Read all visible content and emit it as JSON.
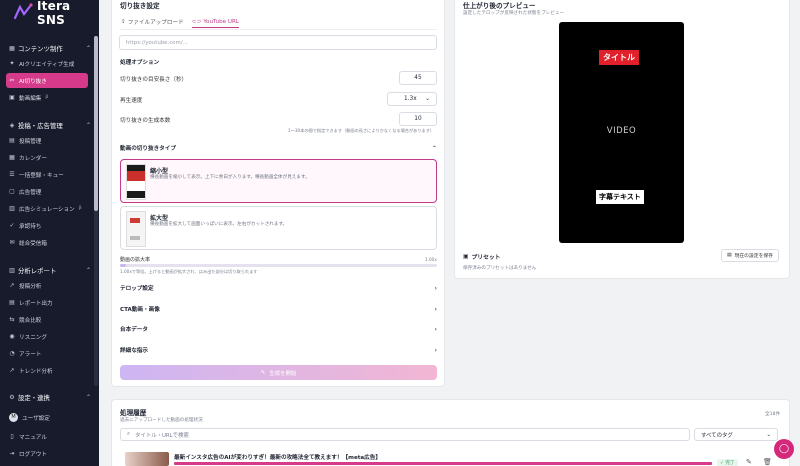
{
  "app": {
    "name": "Itera SNS"
  },
  "sidebar": {
    "sections": [
      {
        "label": "コンテンツ制作",
        "items": [
          {
            "label": "AIクリエイティブ生成"
          },
          {
            "label": "AI切り抜き",
            "active": true
          },
          {
            "label": "動画編集",
            "badge": "β"
          }
        ]
      },
      {
        "label": "投稿・広告管理",
        "items": [
          {
            "label": "投稿管理"
          },
          {
            "label": "カレンダー"
          },
          {
            "label": "一括登録・キュー"
          },
          {
            "label": "広告管理"
          },
          {
            "label": "広告シミュレーション",
            "badge": "β"
          },
          {
            "label": "承認待ち"
          },
          {
            "label": "総合受信箱"
          }
        ]
      },
      {
        "label": "分析レポート",
        "items": [
          {
            "label": "投稿分析"
          },
          {
            "label": "レポート出力"
          },
          {
            "label": "競合比較"
          },
          {
            "label": "リスニング"
          },
          {
            "label": "アラート"
          },
          {
            "label": "トレンド分析"
          }
        ]
      }
    ],
    "settings_label": "設定・連携",
    "user_initial": "M",
    "user_label": "ユーザ設定",
    "manual_label": "マニュアル",
    "logout_label": "ログアウト"
  },
  "clip": {
    "title": "切り抜き設定",
    "tabs": [
      {
        "label": "ファイルアップロード"
      },
      {
        "label": "YouTube URL",
        "active": true
      }
    ],
    "url_placeholder": "https://youtube.com/...",
    "options_title": "処理オプション",
    "length_label": "切り抜きの目安長さ（秒）",
    "length_value": "45",
    "speed_label": "再生速度",
    "speed_value": "1.3x",
    "count_label": "切り抜きの生成本数",
    "count_value": "10",
    "count_hint": "1〜30本の間で指定できます（動画の長さによりかなくなる場合があります）",
    "type_title": "動画の切り抜きタイプ",
    "type_options": [
      {
        "name": "縮小型",
        "desc": "横長動画を縮小して表示。上下に余白が入ります。横長動画全体が見えます。",
        "selected": true
      },
      {
        "name": "拡大型",
        "desc": "横長動画を拡大して画面いっぱいに表示。左右がカットされます。",
        "selected": false
      }
    ],
    "zoom_label": "動画の拡大率",
    "zoom_value": "1.00x",
    "zoom_fraction": 0.0,
    "zoom_hint": "1.00xで等倍。上げると動画が拡大され、はみ出た部分は切り取られます",
    "accordion": [
      "テロップ設定",
      "CTA動画・画像",
      "台本データ",
      "詳細な指示"
    ],
    "generate_label": "生成を開始"
  },
  "preview": {
    "title": "仕上がり後のプレビュー",
    "subtitle": "設定したテロップが反映された状態をプレビュー",
    "telop": "タイトル",
    "video_label": "VIDEO",
    "caption": "字幕テキスト",
    "preset_title": "プリセット",
    "save_label": "現在の設定を保存",
    "empty_label": "保存済みのプリセットはありません"
  },
  "history": {
    "title": "処理履歴",
    "subtitle": "過去にアップロードした動画の処理状況",
    "count": "全18件",
    "search_placeholder": "タイトル・URLで検索",
    "tag_value": "すべてのタグ",
    "rows": [
      {
        "title": "最新インスタ広告のAIが変わりすぎ！最新の攻略法全て教えます！【meta広告】",
        "status": "完了"
      }
    ]
  },
  "colors": {
    "accent": "#d63a8a",
    "sidebar": "#171b2c",
    "telop": "#e0202a"
  }
}
